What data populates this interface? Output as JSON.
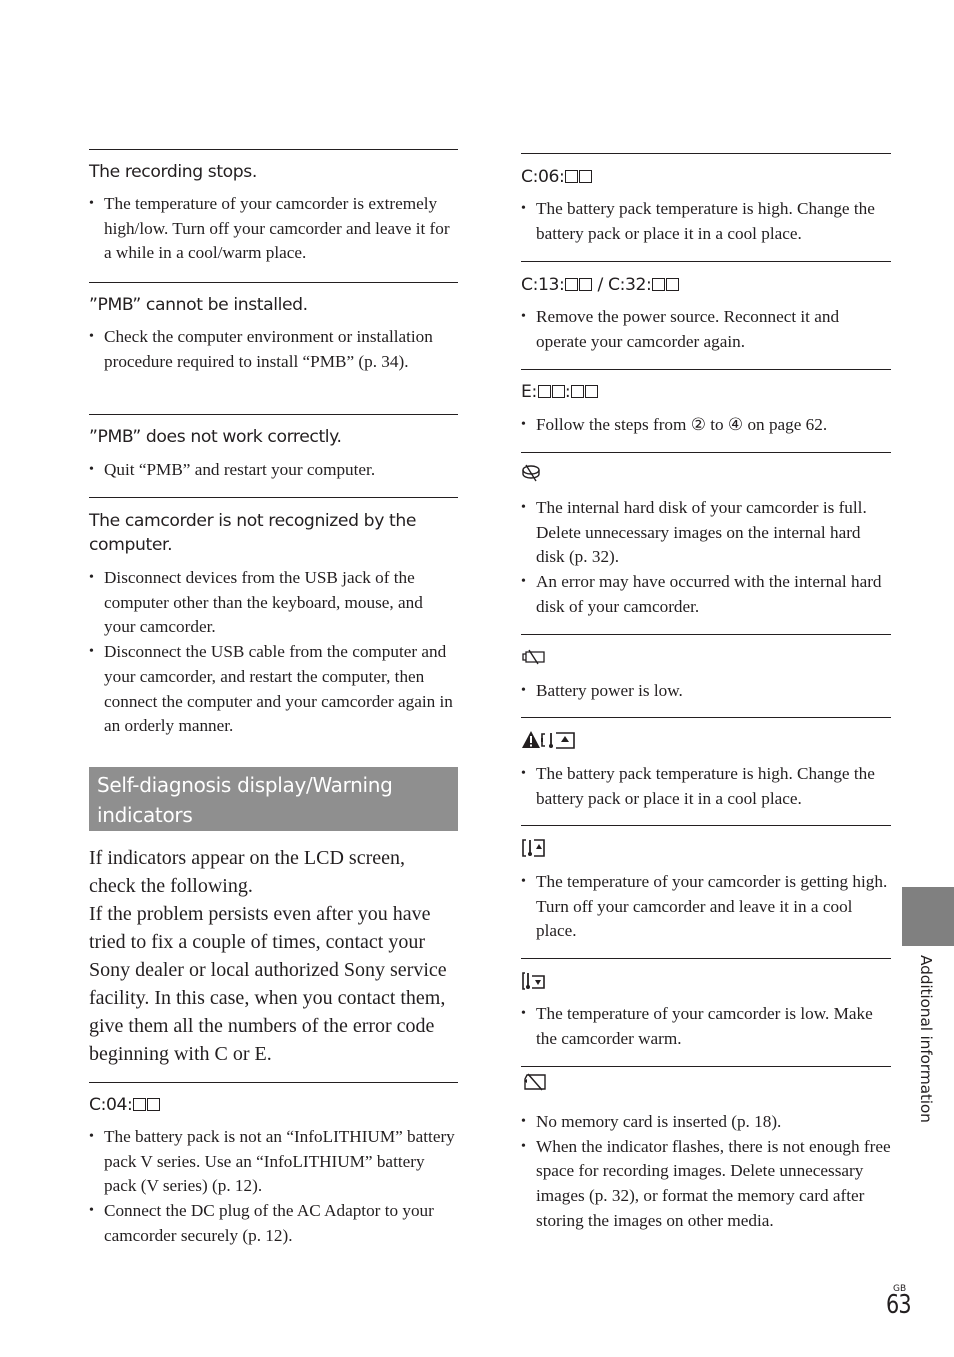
{
  "left_column": {
    "entries": [
      {
        "heading": "The recording stops.",
        "bullets": [
          "The temperature of your camcorder is extremely high/low. Turn off your camcorder and leave it for a while in a cool/warm place."
        ]
      },
      {
        "heading": "”PMB” cannot be installed.",
        "bullets": [
          "Check the computer environment or installation procedure required to install “PMB” (p. 34)."
        ]
      },
      {
        "heading": "”PMB” does not work correctly.",
        "bullets": [
          "Quit “PMB” and restart your computer."
        ]
      },
      {
        "heading": "The camcorder is not recognized by the computer.",
        "bullets": [
          "Disconnect devices from the USB jack of the computer other than the keyboard, mouse, and your camcorder.",
          "Disconnect the USB cable from the computer and your camcorder, and restart the computer, then connect the computer and your camcorder again in an orderly manner."
        ]
      }
    ],
    "section_title": "Self-diagnosis display/Warning indicators",
    "intro": [
      "If indicators appear on the LCD screen, check the following.",
      "If the problem persists even after you have tried to fix a couple of times, contact your Sony dealer or local authorized Sony service facility. In this case, when you contact them, give them all the numbers of the error code beginning with C or E."
    ],
    "c04": {
      "code_prefix": "C:04:",
      "bullets": [
        "The battery pack is not an “InfoLITHIUM” battery pack V series. Use an “InfoLITHIUM” battery pack (V series) (p. 12).",
        "Connect the DC plug of the AC Adaptor to your camcorder securely (p. 12)."
      ]
    }
  },
  "right_column": {
    "c06": {
      "code_prefix": "C:06:",
      "bullets": [
        "The battery pack temperature is high. Change the battery pack or place it in a cool place."
      ]
    },
    "c13_c32": {
      "code_prefix_a": "C:13:",
      "separator": " / ",
      "code_prefix_b": "C:32:",
      "bullets": [
        "Remove the power source. Reconnect it and operate your camcorder again."
      ]
    },
    "e_code": {
      "code_prefix": "E:",
      "code_mid": ":",
      "bullet_before": "Follow the steps from ",
      "step_from": "②",
      "bullet_mid": " to ",
      "step_to": "④",
      "bullet_after": " on page 62."
    },
    "hdd_icon_entry": {
      "icon": "hard-disk-error-icon",
      "bullets": [
        "The internal hard disk of your camcorder is full. Delete unnecessary images on the internal hard disk (p. 32).",
        "An error may have occurred with the internal hard disk of your camcorder."
      ]
    },
    "battery_low_entry": {
      "icon": "battery-low-icon",
      "bullets": [
        "Battery power is low."
      ]
    },
    "battery_temp_entry": {
      "icon": "battery-temperature-warning-icon",
      "bullets": [
        "The battery pack temperature is high. Change the battery pack or place it in a cool place."
      ]
    },
    "temp_high_entry": {
      "icon": "temperature-high-icon",
      "bullets": [
        "The temperature of your camcorder is getting high. Turn off your camcorder and leave it in a cool place."
      ]
    },
    "temp_low_entry": {
      "icon": "temperature-low-icon",
      "bullets": [
        "The temperature of your camcorder is low. Make the camcorder warm."
      ]
    },
    "no_card_entry": {
      "icon": "no-memory-card-icon",
      "bullets": [
        "No memory card is inserted (p. 18).",
        "When the indicator flashes, there is not enough free space for recording images. Delete unnecessary images (p. 32), or format the memory card after storing the images on other media."
      ]
    }
  },
  "side_tab": {
    "label": "Additional information",
    "color": "#808080"
  },
  "footer": {
    "region": "GB",
    "page_number": "63"
  },
  "colors": {
    "banner": "#8f8f8f",
    "text": "#231f20"
  }
}
